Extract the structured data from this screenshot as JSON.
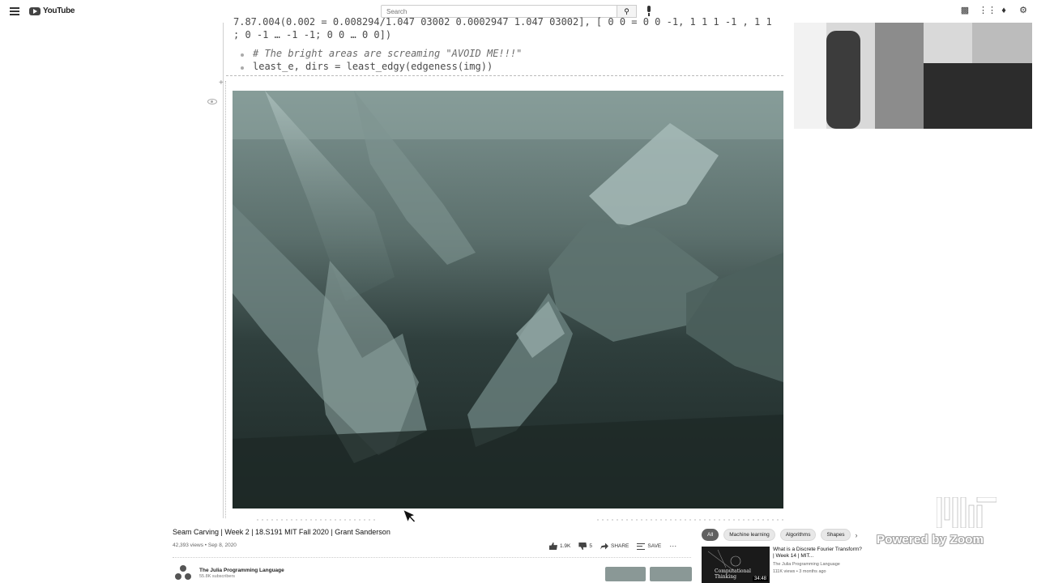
{
  "topbar": {
    "logo_text": "YouTube",
    "search_placeholder": "Search",
    "icons": [
      "create-video-icon",
      "apps-grid-icon",
      "notifications-bell-icon",
      "settings-gear-icon"
    ]
  },
  "notebook": {
    "code_line_1": "7.87.004(0.002 = 0.008294/1.047 03002 0.0002947 1.047 03002], [ 0 0 = 0 0 -1, 1 1 1 -1 , 1 1",
    "code_line_2": "; 0 -1 … -1 -1; 0 0 … 0 0])",
    "code_comment": "# The bright areas are screaming \"AVOID ME!!!\"",
    "code_line_4": "least_e, dirs = least_edgy(edgeness(img))"
  },
  "video": {
    "title": "Seam Carving | Week 2 | 18.S191 MIT Fall 2020 | Grant Sanderson",
    "views": "42,393 views",
    "date": "Sep 8, 2020",
    "likes": "1.9K",
    "dislikes": "5",
    "share_label": "SHARE",
    "save_label": "SAVE",
    "channel_name": "The Julia Programming Language",
    "channel_subs": "55.8K subscribers"
  },
  "sidebar": {
    "chips": [
      "All",
      "Machine learning",
      "Algorithms",
      "Shapes"
    ],
    "recommendation": {
      "title": "What is a Discrete Fourier Transform? | Week 14 | MIT...",
      "channel": "The Julia Programming Language",
      "stats": "111K views • 3 months ago",
      "duration": "34:48",
      "thumb_text": "Computational Thinking"
    }
  },
  "watermark": {
    "powered_text": "Powered by Zoom"
  },
  "colors": {
    "image_dark": "#1f2b29",
    "image_mid": "#5c6f6c",
    "image_light": "#9fb3b0"
  }
}
